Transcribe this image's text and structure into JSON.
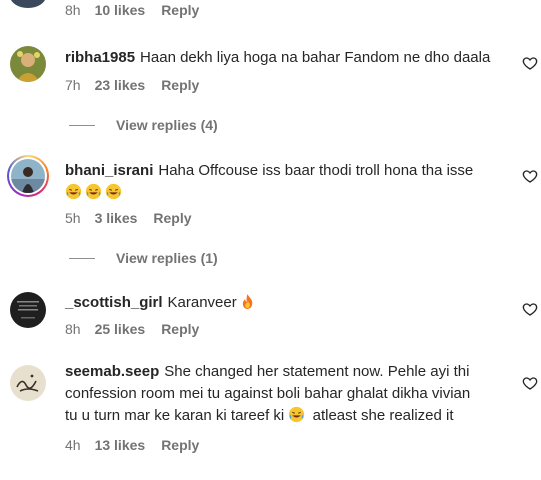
{
  "comments": [
    {
      "time": "8h",
      "likes": "10 likes",
      "reply": "Reply"
    },
    {
      "username": "ribha1985",
      "text": "Haan dekh liya hoga na bahar Fandom ne dho daala",
      "time": "7h",
      "likes": "23 likes",
      "reply": "Reply",
      "view_replies": "View replies (4)"
    },
    {
      "username": "bhani_israni",
      "text": "Haha Offcouse iss baar thodi troll hona tha isse",
      "time": "5h",
      "likes": "3 likes",
      "reply": "Reply",
      "view_replies": "View replies (1)"
    },
    {
      "username": "_scottish_girl",
      "text": "Karanveer",
      "time": "8h",
      "likes": "25 likes",
      "reply": "Reply"
    },
    {
      "username": "seemab.seep",
      "text_line1": "She changed her statement now. Pehle ayi thi",
      "text_line2": "confession room mei tu against boli bahar ghalat dikha vivian",
      "text_line3a": "tu u turn mar ke karan ki tareef ki",
      "text_line3b": "atleast she realized it",
      "time": "4h",
      "likes": "13 likes",
      "reply": "Reply"
    }
  ],
  "icons": {
    "like": "heart-outline-icon",
    "emoji_laugh": "tears-of-joy-emoji",
    "emoji_fire": "fire-emoji"
  },
  "colors": {
    "text": "#262626",
    "muted": "#737373",
    "background": "#ffffff"
  }
}
